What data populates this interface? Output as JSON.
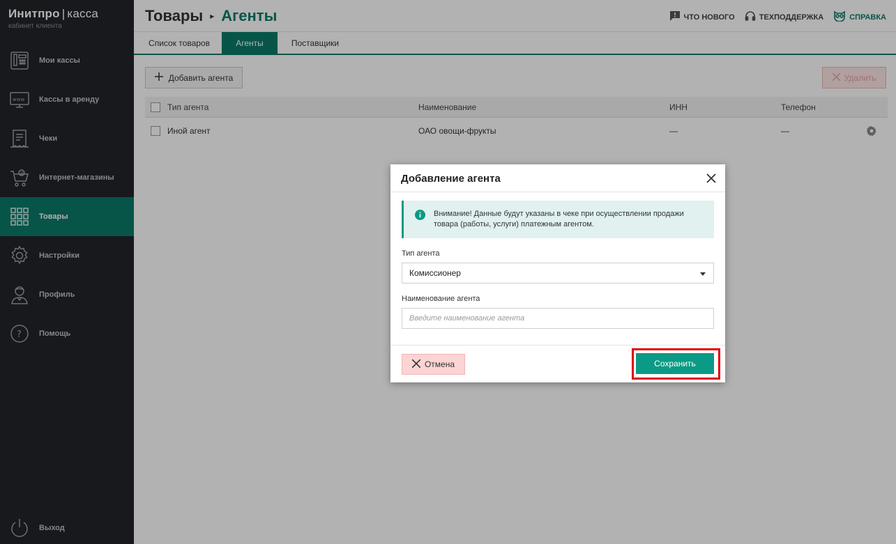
{
  "brand": {
    "name_bold": "Инитпро",
    "separator": "|",
    "name_light": "касса",
    "subtitle": "кабинет клиента"
  },
  "sidebar": {
    "items": [
      {
        "label": "Мои кассы",
        "icon": "cash-register-icon",
        "active": false
      },
      {
        "label": "Кассы в аренду",
        "icon": "www-register-icon",
        "active": false
      },
      {
        "label": "Чеки",
        "icon": "receipt-icon",
        "active": false
      },
      {
        "label": "Интернет-магазины",
        "icon": "shopping-cart-icon",
        "active": false
      },
      {
        "label": "Товары",
        "icon": "grid-icon",
        "active": true
      },
      {
        "label": "Настройки",
        "icon": "gear-icon",
        "active": false
      },
      {
        "label": "Профиль",
        "icon": "user-icon",
        "active": false
      },
      {
        "label": "Помощь",
        "icon": "question-icon",
        "active": false
      }
    ],
    "logout_label": "Выход"
  },
  "header": {
    "breadcrumb_parent": "Товары",
    "breadcrumb_current": "Агенты",
    "links": [
      {
        "label": "ЧТО НОВОГО",
        "icon": "message-icon"
      },
      {
        "label": "ТЕХПОДДЕРЖКА",
        "icon": "headset-icon"
      },
      {
        "label": "СПРАВКА",
        "icon": "owl-icon"
      }
    ]
  },
  "tabs": [
    {
      "label": "Список товаров",
      "active": false
    },
    {
      "label": "Агенты",
      "active": true
    },
    {
      "label": "Поставщики",
      "active": false
    }
  ],
  "toolbar": {
    "add_label": "Добавить агента",
    "delete_label": "Удалить"
  },
  "table": {
    "columns": [
      "Тип агента",
      "Наименование",
      "ИНН",
      "Телефон"
    ],
    "rows": [
      {
        "type": "Иной агент",
        "name": "ОАО овощи-фрукты",
        "inn": "—",
        "phone": "—"
      }
    ]
  },
  "modal": {
    "title": "Добавление агента",
    "alert_text": "Внимание! Данные будут указаны в чеке при осуществлении продажи товара (работы, услуги) платежным агентом.",
    "type_label": "Тип агента",
    "type_value": "Комиссионер",
    "name_label": "Наименование агента",
    "name_placeholder": "Введите наименование агента",
    "name_value": "",
    "cancel_label": "Отмена",
    "save_label": "Сохранить"
  },
  "colors": {
    "accent": "#0b7a68",
    "sidebar_bg": "#212429",
    "save_button": "#0b9a85",
    "highlight": "#e00000"
  }
}
